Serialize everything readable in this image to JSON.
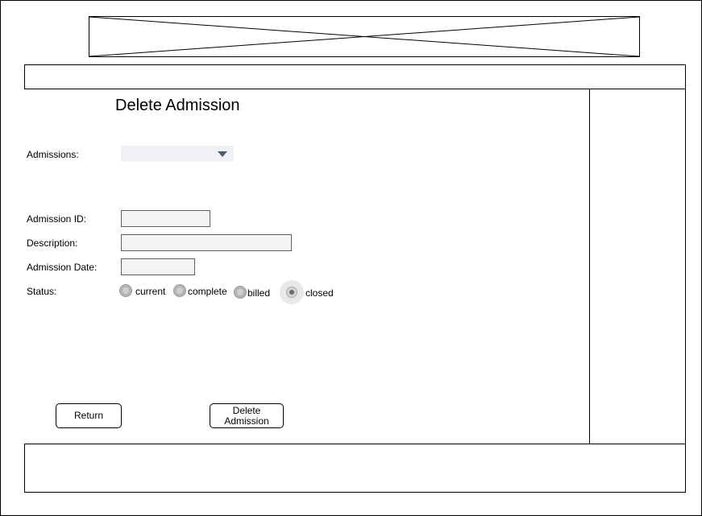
{
  "page": {
    "title": "Delete Admission"
  },
  "form": {
    "admissions_label": "Admissions:",
    "admissions_value": "",
    "admission_id_label": "Admission ID:",
    "admission_id_value": "",
    "description_label": "Description:",
    "description_value": "",
    "admission_date_label": "Admission Date:",
    "admission_date_value": "",
    "status_label": "Status:",
    "status_options": [
      {
        "label": "current",
        "selected": false
      },
      {
        "label": "complete",
        "selected": false
      },
      {
        "label": "billed",
        "selected": false
      },
      {
        "label": "closed",
        "selected": true
      }
    ]
  },
  "buttons": {
    "return_label": "Return",
    "delete_label_line1": "Delete",
    "delete_label_line2": "Admission"
  },
  "icons": {
    "logo_placeholder": "image-placeholder-icon",
    "dropdown_caret": "chevron-down-icon"
  },
  "colors": {
    "dropdown_bg": "#f0f1f4",
    "caret": "#4b5a6e",
    "field_bg": "#f4f4f4"
  }
}
